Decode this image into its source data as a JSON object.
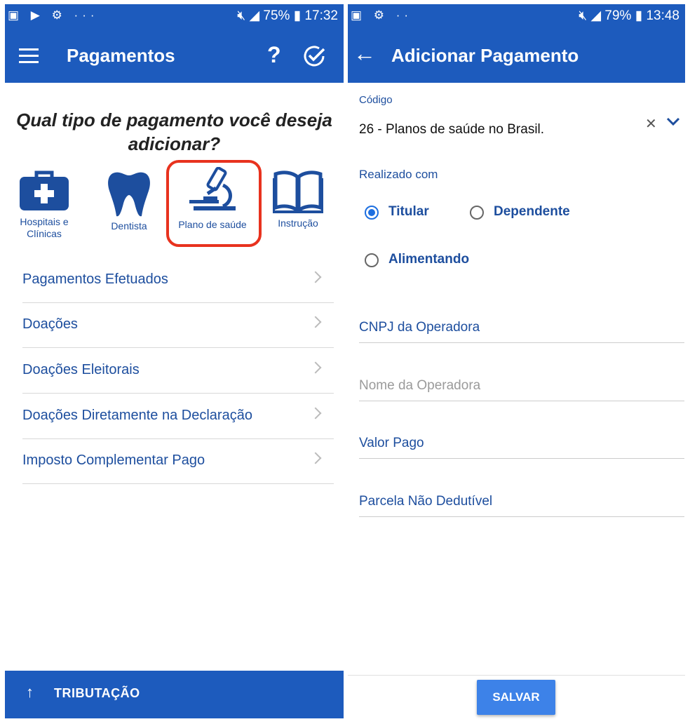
{
  "colors": {
    "primary": "#1d5bbd",
    "text_blue": "#1d4e9e",
    "highlight": "#e8321e",
    "radio_active": "#1d6fe0",
    "save_button": "#3d82e8"
  },
  "left": {
    "status": {
      "icons_left": "▣ ▶ ⚙ ···",
      "battery": "75%",
      "time": "17:32"
    },
    "appbar": {
      "title": "Pagamentos",
      "menu_icon": "hamburger-menu-icon",
      "help_label": "?",
      "confirm_icon": "check-circle-icon"
    },
    "heading": {
      "line1": "Qual tipo de pagamento você deseja",
      "line2": "adicionar?"
    },
    "categories": [
      {
        "line1": "Hospitais e",
        "line2": "Clínicas",
        "icon": "medical-kit-icon"
      },
      {
        "line1": "Dentista",
        "line2": "",
        "icon": "tooth-icon"
      },
      {
        "line1": "Plano de saúde",
        "line2": "",
        "icon": "microscope-icon"
      },
      {
        "line1": "Instrução",
        "line2": "",
        "icon": "book-icon"
      }
    ],
    "menu": [
      {
        "label": "Pagamentos Efetuados"
      },
      {
        "label": "Doações"
      },
      {
        "label": "Doações Eleitorais"
      },
      {
        "label": "Doações Diretamente na Declaração"
      },
      {
        "label": "Imposto Complementar Pago"
      }
    ],
    "bottom": {
      "label": "TRIBUTAÇÃO",
      "arrow": "↑"
    }
  },
  "right": {
    "status": {
      "icons_left": "▣ ⚙ ··",
      "battery": "79%",
      "time": "13:48"
    },
    "appbar": {
      "title": "Adicionar Pagamento",
      "back_label": "←"
    },
    "codigo": {
      "label": "Código",
      "value": "26 - Planos de saúde no Brasil.",
      "clear": "✕"
    },
    "realizado": {
      "label": "Realizado com",
      "options": [
        {
          "label": "Titular",
          "checked": true
        },
        {
          "label": "Dependente",
          "checked": false
        },
        {
          "label": "Alimentando",
          "checked": false
        }
      ]
    },
    "fields": {
      "cnpj": "CNPJ da Operadora",
      "nome": "Nome da Operadora",
      "valor": "Valor Pago",
      "parcela": "Parcela Não Dedutível"
    },
    "save_label": "SALVAR"
  }
}
